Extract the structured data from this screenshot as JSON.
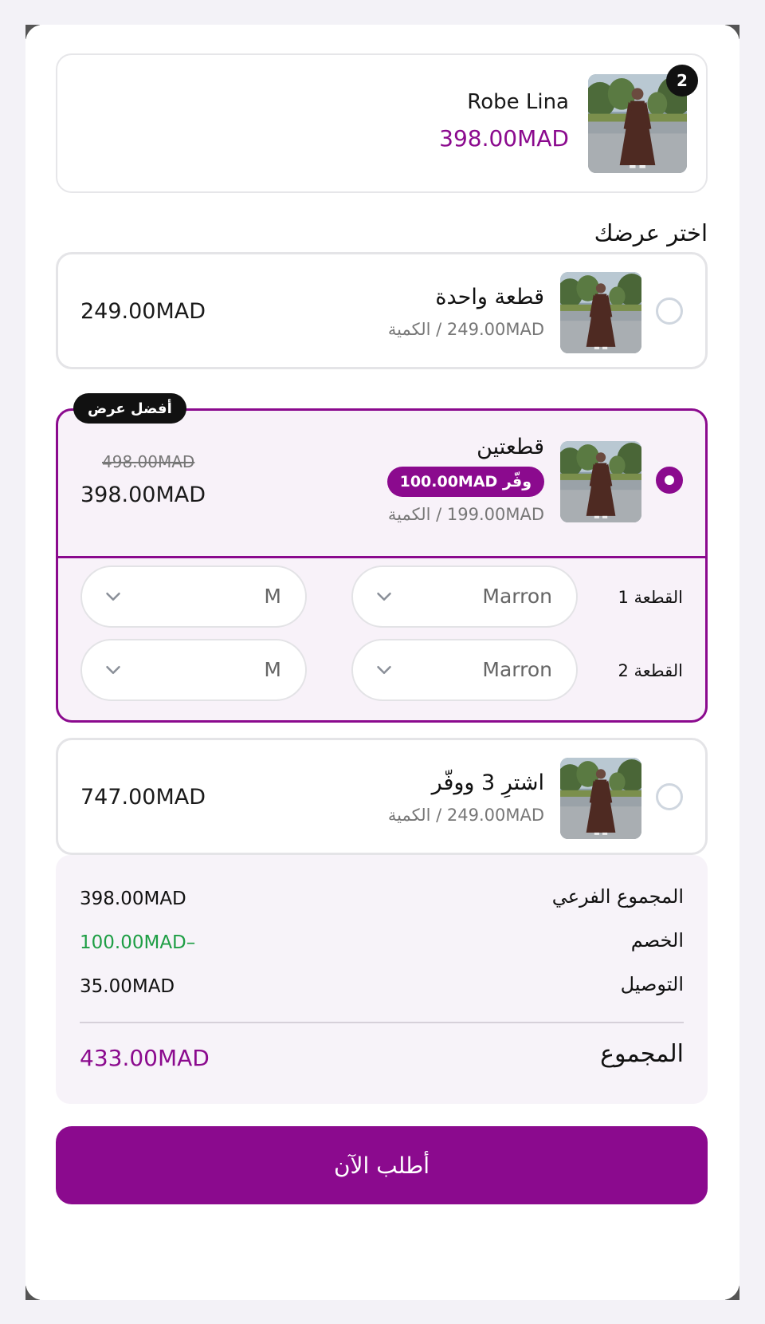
{
  "product": {
    "name": "Robe Lina",
    "price": "398.00MAD",
    "quantity_badge": "2",
    "image_icon": "dress-photo"
  },
  "choose_offer": "اختر عرضك",
  "offers": [
    {
      "title": "قطعة واحدة",
      "unit": "249.00MAD / الكمية",
      "price": "249.00MAD",
      "selected": false
    },
    {
      "title": "قطعتين",
      "unit": "199.00MAD / الكمية",
      "price": "398.00MAD",
      "old_price": "498.00MAD",
      "save": "وفّر 100.00MAD",
      "badge": "أفضل عرض",
      "selected": true,
      "variants": [
        {
          "label": "القطعة 1",
          "color": "Marron",
          "size": "M"
        },
        {
          "label": "القطعة 2",
          "color": "Marron",
          "size": "M"
        }
      ]
    },
    {
      "title": "اشترِ 3 ووفّر",
      "unit": "249.00MAD / الكمية",
      "price": "747.00MAD",
      "selected": false
    }
  ],
  "summary": {
    "subtotal_label": "المجموع الفرعي",
    "subtotal": "398.00MAD",
    "discount_label": "الخصم",
    "discount": "100.00MAD–",
    "shipping_label": "التوصيل",
    "shipping": "35.00MAD",
    "total_label": "المجموع",
    "total": "433.00MAD"
  },
  "cta": "أطلب الآن",
  "colors": {
    "accent": "#8b0a8e",
    "discount_green": "#1e9e45",
    "selected_bg": "#f8f2f9",
    "summary_bg": "#f7f3f9"
  }
}
